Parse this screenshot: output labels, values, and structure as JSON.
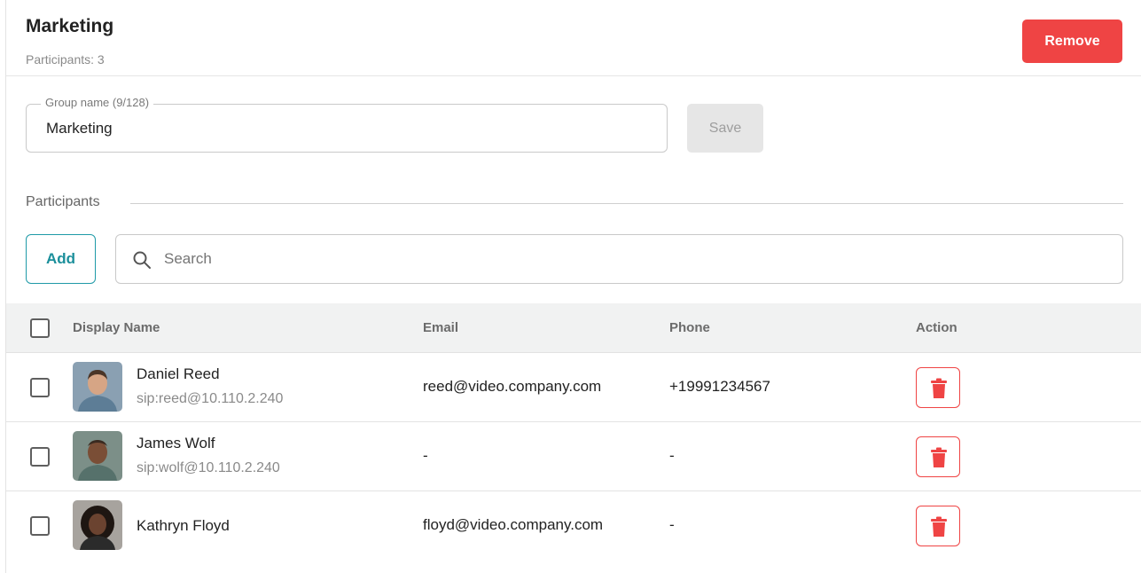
{
  "header": {
    "title": "Marketing",
    "participants_count": "Participants: 3",
    "remove_label": "Remove"
  },
  "group_form": {
    "legend": "Group name (9/128)",
    "value": "Marketing",
    "save_label": "Save"
  },
  "participants_section": {
    "label": "Participants",
    "add_label": "Add",
    "search_placeholder": "Search"
  },
  "table": {
    "columns": [
      "Display Name",
      "Email",
      "Phone",
      "Action"
    ],
    "rows": [
      {
        "name": "Daniel Reed",
        "sip": "sip:reed@10.110.2.240",
        "email": "reed@video.company.com",
        "phone": "+19991234567",
        "avatar_bg": "#8aa0b2",
        "avatar_skin": "#d6a585",
        "avatar_hair": "#4a3527",
        "avatar_shirt": "#5d7d96"
      },
      {
        "name": "James Wolf",
        "sip": "sip:wolf@10.110.2.240",
        "email": "-",
        "phone": "-",
        "avatar_bg": "#7c8f88",
        "avatar_skin": "#7a4e36",
        "avatar_hair": "#3a2a20",
        "avatar_shirt": "#56716b"
      },
      {
        "name": "Kathryn Floyd",
        "sip": "",
        "email": "floyd@video.company.com",
        "phone": "-",
        "avatar_bg": "#a7a39e",
        "avatar_skin": "#6b4330",
        "avatar_hair": "#1e1612",
        "avatar_shirt": "#2b2b2b"
      }
    ]
  },
  "colors": {
    "accent_red": "#ef4444",
    "accent_teal": "#1f9aa7"
  },
  "icons": {
    "search": "search-icon",
    "delete": "trash-icon",
    "checkbox": "checkbox-icon"
  }
}
